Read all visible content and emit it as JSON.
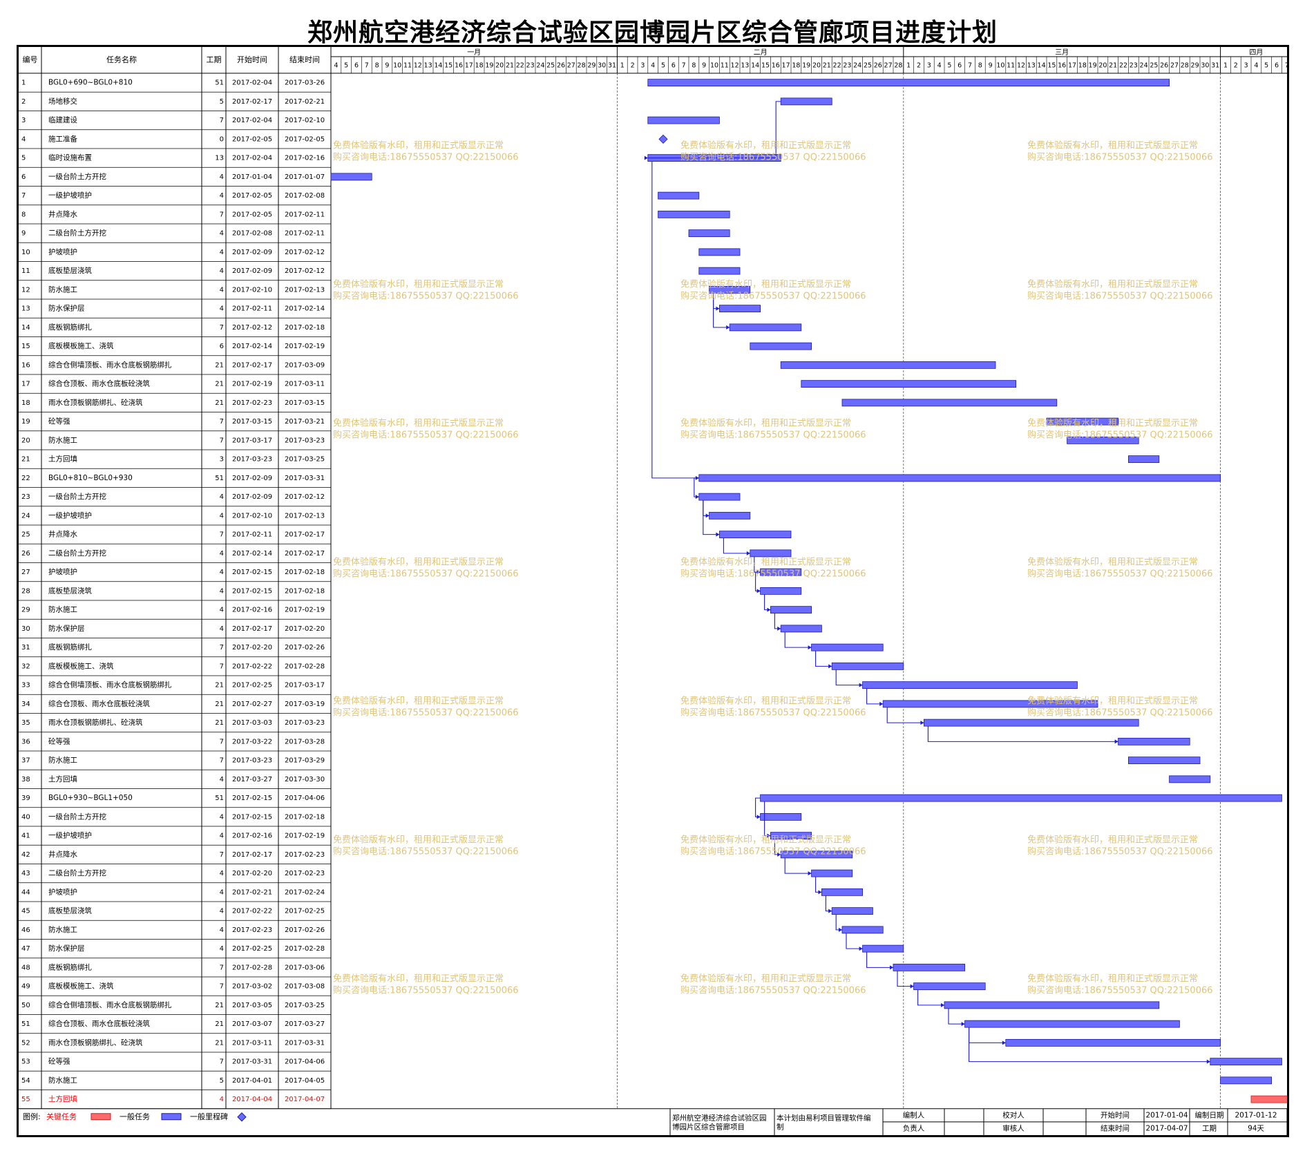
{
  "title": "郑州航空港经济综合试验区园博园片区综合管廊项目进度计划",
  "colors": {
    "normal": "#6a6aff",
    "normal_border": "#1a1aaa",
    "critical": "#ff6b6b",
    "critical_text": "#ff0000",
    "milestone": "#6a6aff",
    "link": "#1a1adb",
    "watermark": "#e0c47a"
  },
  "columns": [
    "编号",
    "任务名称",
    "工期",
    "开始时间",
    "结束时间"
  ],
  "months": [
    {
      "label": "一月",
      "days": [
        "4",
        "5",
        "6",
        "7",
        "8",
        "9",
        "10",
        "11",
        "12",
        "13",
        "14",
        "15",
        "16",
        "17",
        "18",
        "19",
        "20",
        "21",
        "22",
        "23",
        "24",
        "25",
        "26",
        "27",
        "28",
        "29",
        "30",
        "31"
      ]
    },
    {
      "label": "二月",
      "days": [
        "1",
        "2",
        "3",
        "4",
        "5",
        "6",
        "7",
        "8",
        "9",
        "10",
        "11",
        "12",
        "13",
        "14",
        "15",
        "16",
        "17",
        "18",
        "19",
        "20",
        "21",
        "22",
        "23",
        "24",
        "25",
        "26",
        "27",
        "28"
      ]
    },
    {
      "label": "三月",
      "days": [
        "1",
        "2",
        "3",
        "4",
        "5",
        "6",
        "7",
        "8",
        "9",
        "10",
        "11",
        "12",
        "13",
        "14",
        "15",
        "16",
        "17",
        "18",
        "19",
        "20",
        "21",
        "22",
        "23",
        "24",
        "25",
        "26",
        "27",
        "28",
        "29",
        "30",
        "31"
      ]
    },
    {
      "label": "四月",
      "days": [
        "1",
        "2",
        "3",
        "4",
        "5",
        "6",
        "7"
      ]
    }
  ],
  "watermark": {
    "line1": "免费体验版有水印，租用和正式版显示正常",
    "line2": "购买咨询电话:18675550537 QQ:22150066"
  },
  "tasks": [
    {
      "id": "1",
      "name": "BGL0+690~BGL0+810",
      "duration": "51",
      "start": "2017-02-04",
      "end": "2017-03-26"
    },
    {
      "id": "2",
      "name": "场地移交",
      "duration": "5",
      "start": "2017-02-17",
      "end": "2017-02-21"
    },
    {
      "id": "3",
      "name": "临建建设",
      "duration": "7",
      "start": "2017-02-04",
      "end": "2017-02-10"
    },
    {
      "id": "4",
      "name": "施工准备",
      "duration": "0",
      "start": "2017-02-05",
      "end": "2017-02-05",
      "milestone": true
    },
    {
      "id": "5",
      "name": "临时设施布置",
      "duration": "13",
      "start": "2017-02-04",
      "end": "2017-02-16"
    },
    {
      "id": "6",
      "name": "一级台阶土方开挖",
      "duration": "4",
      "start": "2017-01-04",
      "end": "2017-01-07"
    },
    {
      "id": "7",
      "name": "一级护坡喷护",
      "duration": "4",
      "start": "2017-02-05",
      "end": "2017-02-08"
    },
    {
      "id": "8",
      "name": "井点降水",
      "duration": "7",
      "start": "2017-02-05",
      "end": "2017-02-11"
    },
    {
      "id": "9",
      "name": "二级台阶土方开挖",
      "duration": "4",
      "start": "2017-02-08",
      "end": "2017-02-11"
    },
    {
      "id": "10",
      "name": "护坡喷护",
      "duration": "4",
      "start": "2017-02-09",
      "end": "2017-02-12"
    },
    {
      "id": "11",
      "name": "底板垫层浇筑",
      "duration": "4",
      "start": "2017-02-09",
      "end": "2017-02-12"
    },
    {
      "id": "12",
      "name": "防水施工",
      "duration": "4",
      "start": "2017-02-10",
      "end": "2017-02-13"
    },
    {
      "id": "13",
      "name": "防水保护层",
      "duration": "4",
      "start": "2017-02-11",
      "end": "2017-02-14"
    },
    {
      "id": "14",
      "name": "底板钢筋绑扎",
      "duration": "7",
      "start": "2017-02-12",
      "end": "2017-02-18"
    },
    {
      "id": "15",
      "name": "底板模板施工、浇筑",
      "duration": "6",
      "start": "2017-02-14",
      "end": "2017-02-19"
    },
    {
      "id": "16",
      "name": "综合仓侧墙顶板、雨水仓底板钢筋绑扎",
      "duration": "21",
      "start": "2017-02-17",
      "end": "2017-03-09"
    },
    {
      "id": "17",
      "name": "综合仓顶板、雨水仓底板砼浇筑",
      "duration": "21",
      "start": "2017-02-19",
      "end": "2017-03-11"
    },
    {
      "id": "18",
      "name": "雨水仓顶板钢筋绑扎、砼浇筑",
      "duration": "21",
      "start": "2017-02-23",
      "end": "2017-03-15"
    },
    {
      "id": "19",
      "name": "砼等强",
      "duration": "7",
      "start": "2017-03-15",
      "end": "2017-03-21"
    },
    {
      "id": "20",
      "name": "防水施工",
      "duration": "7",
      "start": "2017-03-17",
      "end": "2017-03-23"
    },
    {
      "id": "21",
      "name": "土方回填",
      "duration": "3",
      "start": "2017-03-23",
      "end": "2017-03-25"
    },
    {
      "id": "22",
      "name": "BGL0+810~BGL0+930",
      "duration": "51",
      "start": "2017-02-09",
      "end": "2017-03-31"
    },
    {
      "id": "23",
      "name": "一级台阶土方开挖",
      "duration": "4",
      "start": "2017-02-09",
      "end": "2017-02-12"
    },
    {
      "id": "24",
      "name": "一级护坡喷护",
      "duration": "4",
      "start": "2017-02-10",
      "end": "2017-02-13"
    },
    {
      "id": "25",
      "name": "井点降水",
      "duration": "7",
      "start": "2017-02-11",
      "end": "2017-02-17"
    },
    {
      "id": "26",
      "name": "二级台阶土方开挖",
      "duration": "4",
      "start": "2017-02-14",
      "end": "2017-02-17"
    },
    {
      "id": "27",
      "name": "护坡喷护",
      "duration": "4",
      "start": "2017-02-15",
      "end": "2017-02-18"
    },
    {
      "id": "28",
      "name": "底板垫层浇筑",
      "duration": "4",
      "start": "2017-02-15",
      "end": "2017-02-18"
    },
    {
      "id": "29",
      "name": "防水施工",
      "duration": "4",
      "start": "2017-02-16",
      "end": "2017-02-19"
    },
    {
      "id": "30",
      "name": "防水保护层",
      "duration": "4",
      "start": "2017-02-17",
      "end": "2017-02-20"
    },
    {
      "id": "31",
      "name": "底板钢筋绑扎",
      "duration": "7",
      "start": "2017-02-20",
      "end": "2017-02-26"
    },
    {
      "id": "32",
      "name": "底板模板施工、浇筑",
      "duration": "7",
      "start": "2017-02-22",
      "end": "2017-02-28"
    },
    {
      "id": "33",
      "name": "综合仓侧墙顶板、雨水仓底板钢筋绑扎",
      "duration": "21",
      "start": "2017-02-25",
      "end": "2017-03-17"
    },
    {
      "id": "34",
      "name": "综合仓顶板、雨水仓底板砼浇筑",
      "duration": "21",
      "start": "2017-02-27",
      "end": "2017-03-19"
    },
    {
      "id": "35",
      "name": "雨水仓顶板钢筋绑扎、砼浇筑",
      "duration": "21",
      "start": "2017-03-03",
      "end": "2017-03-23"
    },
    {
      "id": "36",
      "name": "砼等强",
      "duration": "7",
      "start": "2017-03-22",
      "end": "2017-03-28"
    },
    {
      "id": "37",
      "name": "防水施工",
      "duration": "7",
      "start": "2017-03-23",
      "end": "2017-03-29"
    },
    {
      "id": "38",
      "name": "土方回填",
      "duration": "4",
      "start": "2017-03-27",
      "end": "2017-03-30"
    },
    {
      "id": "39",
      "name": "BGL0+930~BGL1+050",
      "duration": "51",
      "start": "2017-02-15",
      "end": "2017-04-06"
    },
    {
      "id": "40",
      "name": "一级台阶土方开挖",
      "duration": "4",
      "start": "2017-02-15",
      "end": "2017-02-18"
    },
    {
      "id": "41",
      "name": "一级护坡喷护",
      "duration": "4",
      "start": "2017-02-16",
      "end": "2017-02-19"
    },
    {
      "id": "42",
      "name": "井点降水",
      "duration": "7",
      "start": "2017-02-17",
      "end": "2017-02-23"
    },
    {
      "id": "43",
      "name": "二级台阶土方开挖",
      "duration": "4",
      "start": "2017-02-20",
      "end": "2017-02-23"
    },
    {
      "id": "44",
      "name": "护坡喷护",
      "duration": "4",
      "start": "2017-02-21",
      "end": "2017-02-24"
    },
    {
      "id": "45",
      "name": "底板垫层浇筑",
      "duration": "4",
      "start": "2017-02-22",
      "end": "2017-02-25"
    },
    {
      "id": "46",
      "name": "防水施工",
      "duration": "4",
      "start": "2017-02-23",
      "end": "2017-02-26"
    },
    {
      "id": "47",
      "name": "防水保护层",
      "duration": "4",
      "start": "2017-02-25",
      "end": "2017-02-28"
    },
    {
      "id": "48",
      "name": "底板钢筋绑扎",
      "duration": "7",
      "start": "2017-02-28",
      "end": "2017-03-06"
    },
    {
      "id": "49",
      "name": "底板模板施工、浇筑",
      "duration": "7",
      "start": "2017-03-02",
      "end": "2017-03-08"
    },
    {
      "id": "50",
      "name": "综合仓侧墙顶板、雨水仓底板钢筋绑扎",
      "duration": "21",
      "start": "2017-03-05",
      "end": "2017-03-25"
    },
    {
      "id": "51",
      "name": "综合仓顶板、雨水仓底板砼浇筑",
      "duration": "21",
      "start": "2017-03-07",
      "end": "2017-03-27"
    },
    {
      "id": "52",
      "name": "雨水仓顶板钢筋绑扎、砼浇筑",
      "duration": "21",
      "start": "2017-03-11",
      "end": "2017-03-31"
    },
    {
      "id": "53",
      "name": "砼等强",
      "duration": "7",
      "start": "2017-03-31",
      "end": "2017-04-06"
    },
    {
      "id": "54",
      "name": "防水施工",
      "duration": "5",
      "start": "2017-04-01",
      "end": "2017-04-05"
    },
    {
      "id": "55",
      "name": "土方回填",
      "duration": "4",
      "start": "2017-04-04",
      "end": "2017-04-07",
      "critical": true
    }
  ],
  "links": [
    [
      2,
      5
    ],
    [
      5,
      22
    ],
    [
      12,
      13
    ],
    [
      12,
      14
    ],
    [
      22,
      23
    ],
    [
      23,
      24
    ],
    [
      23,
      25
    ],
    [
      25,
      26
    ],
    [
      26,
      27
    ],
    [
      27,
      28
    ],
    [
      28,
      29
    ],
    [
      29,
      30
    ],
    [
      30,
      31
    ],
    [
      31,
      32
    ],
    [
      32,
      33
    ],
    [
      33,
      34
    ],
    [
      34,
      35
    ],
    [
      35,
      36
    ],
    [
      39,
      40
    ],
    [
      39,
      41
    ],
    [
      41,
      42
    ],
    [
      42,
      43
    ],
    [
      43,
      44
    ],
    [
      44,
      45
    ],
    [
      45,
      46
    ],
    [
      46,
      47
    ],
    [
      47,
      48
    ],
    [
      48,
      49
    ],
    [
      49,
      50
    ],
    [
      50,
      51
    ],
    [
      51,
      52
    ],
    [
      51,
      53
    ]
  ],
  "legend": {
    "label": "图例:",
    "critical": "关键任务",
    "normal": "一般任务",
    "milestone": "一般里程碑"
  },
  "footer": {
    "project": "郑州航空港经济综合试验区园博园片区综合管廊项目",
    "software": "本计划由易利项目管理软件编制",
    "author_label": "编制人",
    "author": "",
    "reviewer_label": "校对人",
    "reviewer": "",
    "start_label": "开始时间",
    "start": "2017-01-04",
    "date_label": "编制日期",
    "date": "2017-01-12",
    "owner_label": "负责人",
    "owner": "",
    "auditor_label": "审核人",
    "auditor": "",
    "end_label": "结束时间",
    "end": "2017-04-07",
    "duration_label": "工期",
    "duration": "94天"
  }
}
